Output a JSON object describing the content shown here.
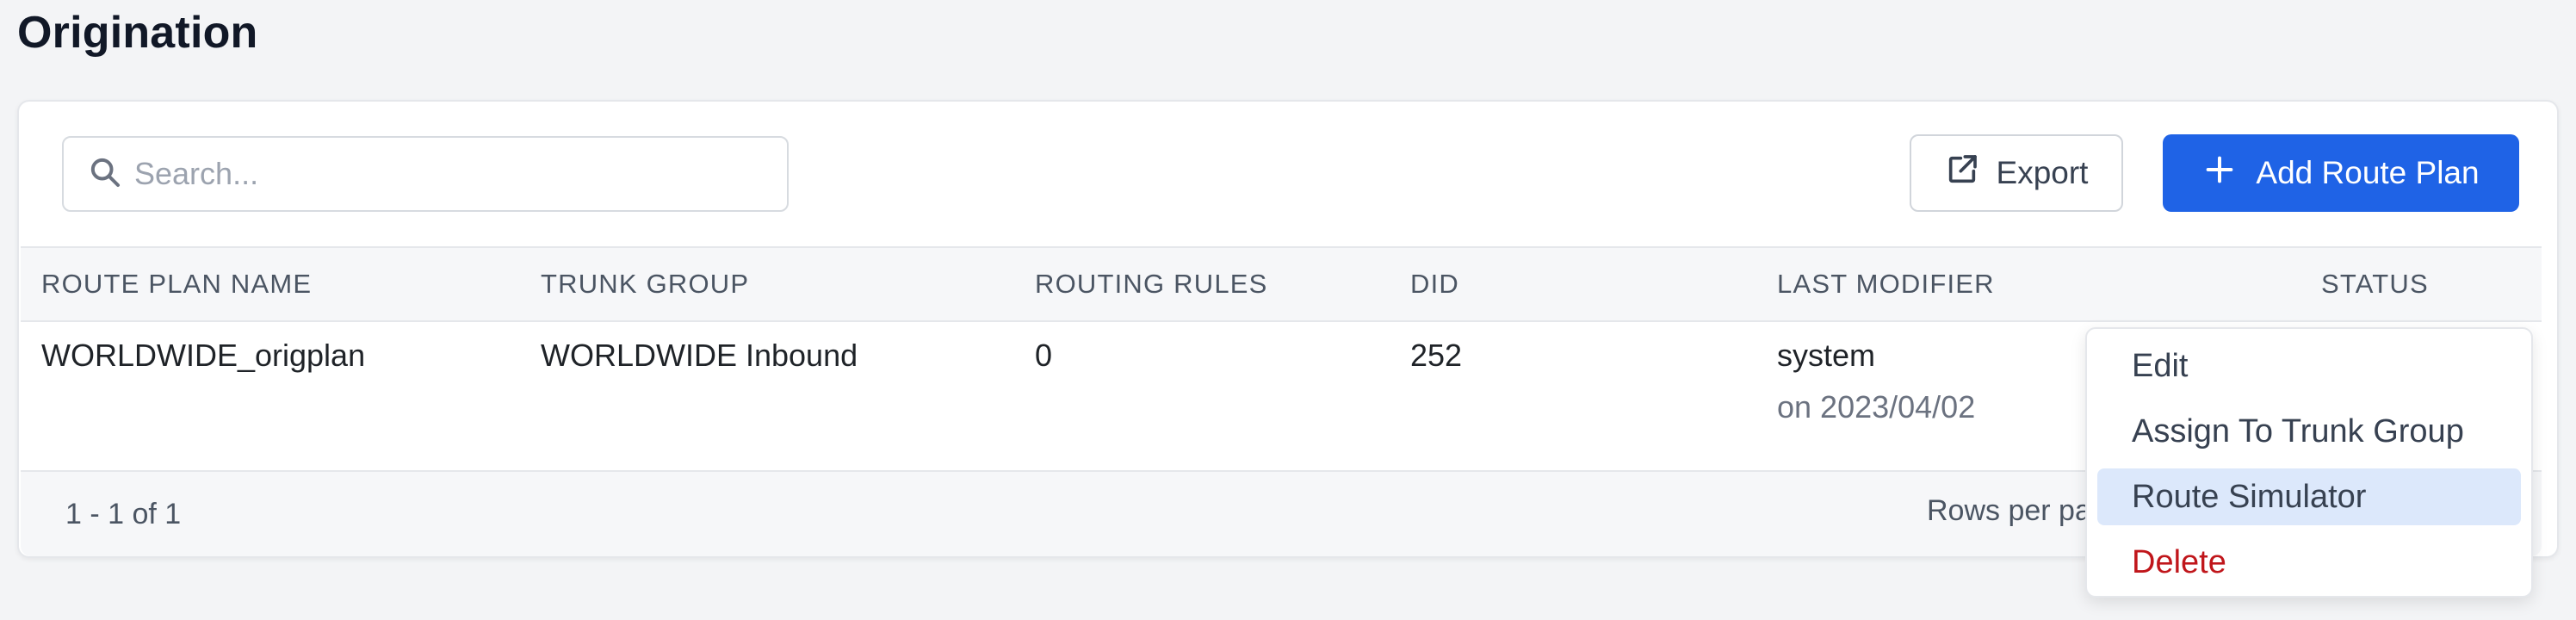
{
  "page": {
    "title": "Origination"
  },
  "toolbar": {
    "search_placeholder": "Search...",
    "export_label": "Export",
    "add_label": "Add Route Plan"
  },
  "table": {
    "columns": [
      "ROUTE PLAN NAME",
      "TRUNK GROUP",
      "ROUTING RULES",
      "DID",
      "LAST MODIFIER",
      "STATUS"
    ],
    "rows": [
      {
        "route_plan_name": "WORLDWIDE_origplan",
        "trunk_group": "WORLDWIDE Inbound",
        "routing_rules": "0",
        "did": "252",
        "last_modifier": "system",
        "modified_on": "on 2023/04/02"
      }
    ]
  },
  "footer": {
    "range_text": "1 - 1 of 1",
    "rows_per_page_label": "Rows per pa"
  },
  "context_menu": {
    "items": [
      {
        "label": "Edit"
      },
      {
        "label": "Assign To Trunk Group"
      },
      {
        "label": "Route Simulator"
      },
      {
        "label": "Delete"
      }
    ],
    "highlighted_index": 2
  },
  "colors": {
    "primary": "#1f63e6",
    "danger": "#c0161b",
    "highlight": "#dce8fb"
  }
}
